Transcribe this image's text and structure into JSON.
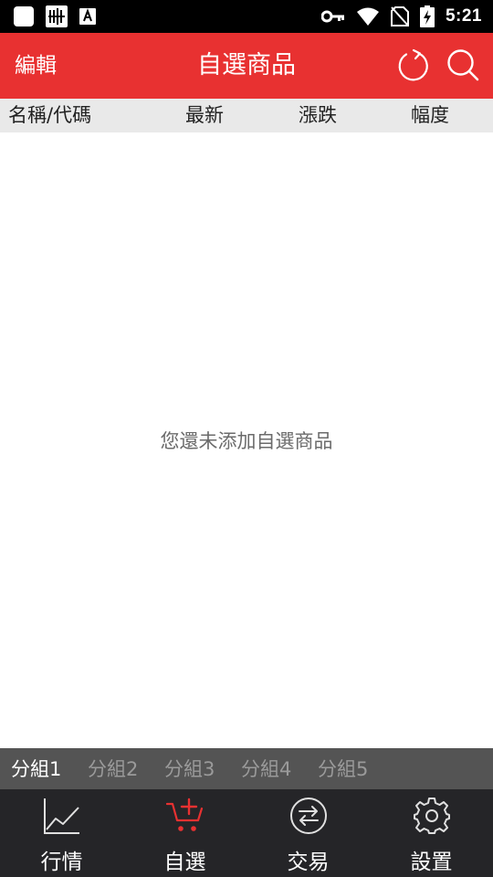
{
  "status_bar": {
    "time": "5:21",
    "left_icons": [
      "app-square-icon",
      "barcode-app-icon",
      "font-app-icon"
    ],
    "right_icons": [
      "vpn-key-icon",
      "wifi-icon",
      "no-sim-icon",
      "battery-charging-icon"
    ]
  },
  "header": {
    "edit_label": "編輯",
    "title": "自選商品",
    "icons": [
      "refresh-icon",
      "search-icon"
    ],
    "color": "#e83131"
  },
  "columns": {
    "name": "名稱/代碼",
    "latest": "最新",
    "change": "漲跌",
    "percent": "幅度"
  },
  "main": {
    "empty_message": "您還未添加自選商品"
  },
  "groups": {
    "tabs": [
      "分組1",
      "分組2",
      "分組3",
      "分組4",
      "分組5"
    ],
    "active_index": 0
  },
  "bottom_nav": {
    "items": [
      {
        "label": "行情",
        "icon": "line-chart-icon"
      },
      {
        "label": "自選",
        "icon": "cart-add-icon"
      },
      {
        "label": "交易",
        "icon": "swap-circle-icon"
      },
      {
        "label": "設置",
        "icon": "gear-icon"
      }
    ],
    "active_index": 1,
    "active_color": "#e83131"
  }
}
